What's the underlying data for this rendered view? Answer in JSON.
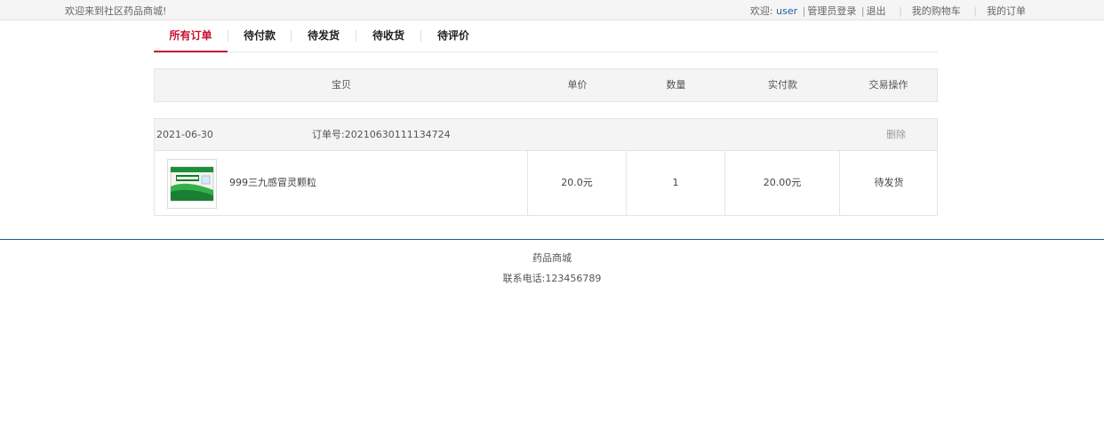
{
  "topbar": {
    "welcome": "欢迎来到社区药品商城!",
    "greeting": "欢迎: ",
    "username": "user",
    "admin_login": "管理员登录",
    "logout": "退出",
    "cart": "我的购物车",
    "orders": "我的订单",
    "sep": "|"
  },
  "tabs": [
    {
      "label": "所有订单",
      "active": true
    },
    {
      "label": "待付款",
      "active": false
    },
    {
      "label": "待发货",
      "active": false
    },
    {
      "label": "待收货",
      "active": false
    },
    {
      "label": "待评价",
      "active": false
    }
  ],
  "table": {
    "headers": [
      "宝贝",
      "单价",
      "数量",
      "实付款",
      "交易操作"
    ]
  },
  "orders": [
    {
      "date": "2021-06-30",
      "order_no": "订单号:20210630111134724",
      "delete_label": "删除",
      "product_name": "999三九感冒灵颗粒",
      "unit_price": "20.0元",
      "quantity": "1",
      "paid": "20.00元",
      "status": "待发货"
    }
  ],
  "footer": {
    "name": "药品商城",
    "phone": "联系电话:123456789"
  },
  "colors": {
    "accent": "#c8102e",
    "footer_line": "#1b5d86",
    "link": "#1a5d9a"
  }
}
